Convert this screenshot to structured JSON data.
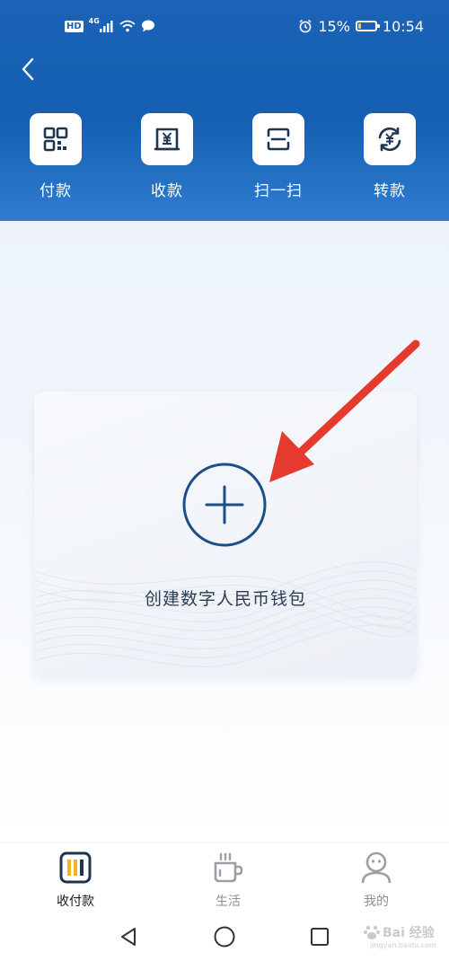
{
  "status_bar": {
    "network": "4G",
    "hd": "HD",
    "battery_percent": "15%",
    "battery_level": 0.15,
    "time": "10:54"
  },
  "header": {
    "back_icon": "chevron-left-icon",
    "actions": [
      {
        "label": "付款",
        "icon": "qr-code-icon"
      },
      {
        "label": "收款",
        "icon": "yuan-receipt-icon"
      },
      {
        "label": "扫一扫",
        "icon": "scan-icon"
      },
      {
        "label": "转款",
        "icon": "yuan-transfer-icon"
      }
    ]
  },
  "wallet_card": {
    "label": "创建数字人民币钱包",
    "add_icon": "plus-circle-icon"
  },
  "bottom_nav": {
    "items": [
      {
        "label": "收付款",
        "icon": "payment-icon",
        "active": true
      },
      {
        "label": "生活",
        "icon": "coffee-cup-icon",
        "active": false
      },
      {
        "label": "我的",
        "icon": "user-icon",
        "active": false
      }
    ]
  },
  "system_nav": {
    "back_icon": "triangle-back-icon",
    "home_icon": "circle-home-icon",
    "recent_icon": "square-recent-icon"
  },
  "watermark": {
    "text": "Bai 经验",
    "sub": "jingyan.baidu.com"
  },
  "colors": {
    "brand_blue": "#1a63b6",
    "header_blue_light": "#2f7cd0",
    "arrow_red": "#e53a2e",
    "nav_active_yellow": "#f3b51b"
  }
}
